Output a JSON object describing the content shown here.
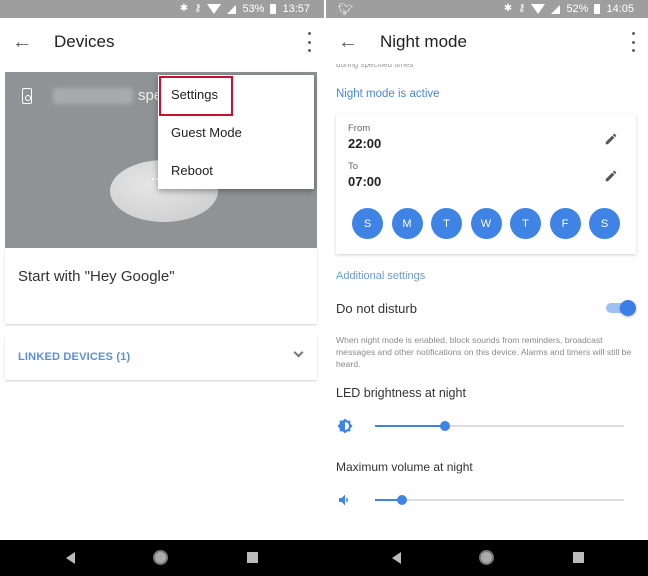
{
  "left": {
    "status": {
      "battery": "53%",
      "time": "13:57"
    },
    "appbar": {
      "title": "Devices"
    },
    "device": {
      "name_suffix": "spe"
    },
    "menu": {
      "items": [
        {
          "label": "Settings",
          "highlighted": true
        },
        {
          "label": "Guest Mode"
        },
        {
          "label": "Reboot"
        }
      ]
    },
    "hey_card": {
      "text": "Start with \"Hey Google\""
    },
    "linked": {
      "label": "LINKED DEVICES (1)"
    }
  },
  "right": {
    "status": {
      "battery": "52%",
      "time": "14:05",
      "notification_icon": "twitter-icon"
    },
    "appbar": {
      "title": "Night mode"
    },
    "cutoff_text": "during specified times",
    "active_label": "Night mode is active",
    "schedule": {
      "from_label": "From",
      "from_time": "22:00",
      "to_label": "To",
      "to_time": "07:00",
      "days": [
        "S",
        "M",
        "T",
        "W",
        "T",
        "F",
        "S"
      ]
    },
    "additional_label": "Additional settings",
    "dnd": {
      "label": "Do not disturb",
      "enabled": true,
      "description": "When night mode is enabled, block sounds from reminders, broadcast messages and other notifications on this device. Alarms and timers will still be heard."
    },
    "led": {
      "label": "LED brightness at night",
      "value_percent": 28
    },
    "volume": {
      "label": "Maximum volume at night",
      "value_percent": 11
    }
  },
  "colors": {
    "accent": "#3f84e5",
    "highlight_box": "#c8102e",
    "statusbar": "#9e9e9e"
  }
}
